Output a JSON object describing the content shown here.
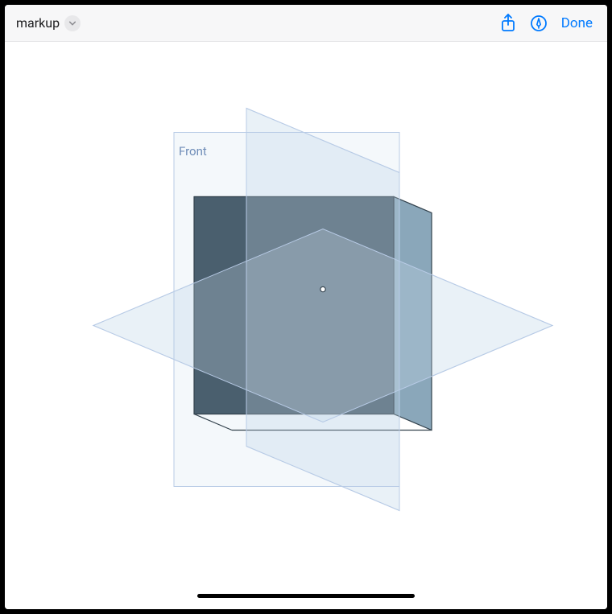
{
  "toolbar": {
    "title": "markup",
    "done_label": "Done"
  },
  "icons": {
    "chevron": "chevron-down-icon",
    "share": "share-icon",
    "markup_pen": "markup-pen-icon"
  },
  "viewport": {
    "plane_label": "Front"
  },
  "colors": {
    "accent": "#007aff",
    "plane_stroke": "#b8cbe6",
    "plane_fill": "rgba(200,220,240,0.25)",
    "solid_front": "#4a5f6e",
    "solid_top": "#9db6c6",
    "solid_side": "#8aa7ba",
    "label": "#6f8db8"
  }
}
